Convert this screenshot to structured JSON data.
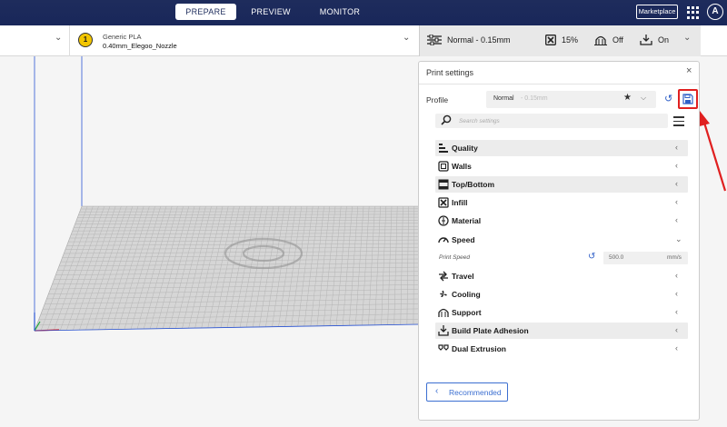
{
  "nav": {
    "tabs": [
      "PREPARE",
      "PREVIEW",
      "MONITOR"
    ],
    "marketplace": "Marketplace",
    "avatar_letter": "A"
  },
  "material": {
    "extruder_number": "1",
    "name": "Generic PLA",
    "nozzle": "0.40mm_Elegoo_Nozzle"
  },
  "settings_bar": {
    "profile": "Normal - 0.15mm",
    "infill": "15%",
    "support": "Off",
    "adhesion": "On"
  },
  "panel": {
    "title": "Print settings",
    "close": "×",
    "profile_label": "Profile",
    "profile_name": "Normal",
    "profile_layer": "- 0.15mm",
    "search_placeholder": "Search settings",
    "categories": [
      {
        "label": "Quality",
        "icon": "quality-icon",
        "expanded": false
      },
      {
        "label": "Walls",
        "icon": "walls-icon",
        "expanded": false
      },
      {
        "label": "Top/Bottom",
        "icon": "top-bottom-icon",
        "expanded": false
      },
      {
        "label": "Infill",
        "icon": "infill-icon",
        "expanded": false
      },
      {
        "label": "Material",
        "icon": "material-icon",
        "expanded": false
      },
      {
        "label": "Speed",
        "icon": "speed-icon",
        "expanded": true
      },
      {
        "label": "Travel",
        "icon": "travel-icon",
        "expanded": false
      },
      {
        "label": "Cooling",
        "icon": "cooling-icon",
        "expanded": false
      },
      {
        "label": "Support",
        "icon": "support-icon",
        "expanded": false
      },
      {
        "label": "Build Plate Adhesion",
        "icon": "adhesion-icon",
        "expanded": false
      },
      {
        "label": "Dual Extrusion",
        "icon": "dual-extrusion-icon",
        "expanded": false
      }
    ],
    "print_speed": {
      "label": "Print Speed",
      "value": "500.0",
      "unit": "mm/s"
    },
    "recommended_button": "Recommended"
  },
  "colors": {
    "topbar": "#1e2c5c",
    "accent_blue": "#3c6fd1",
    "highlight_red": "#e02020"
  }
}
